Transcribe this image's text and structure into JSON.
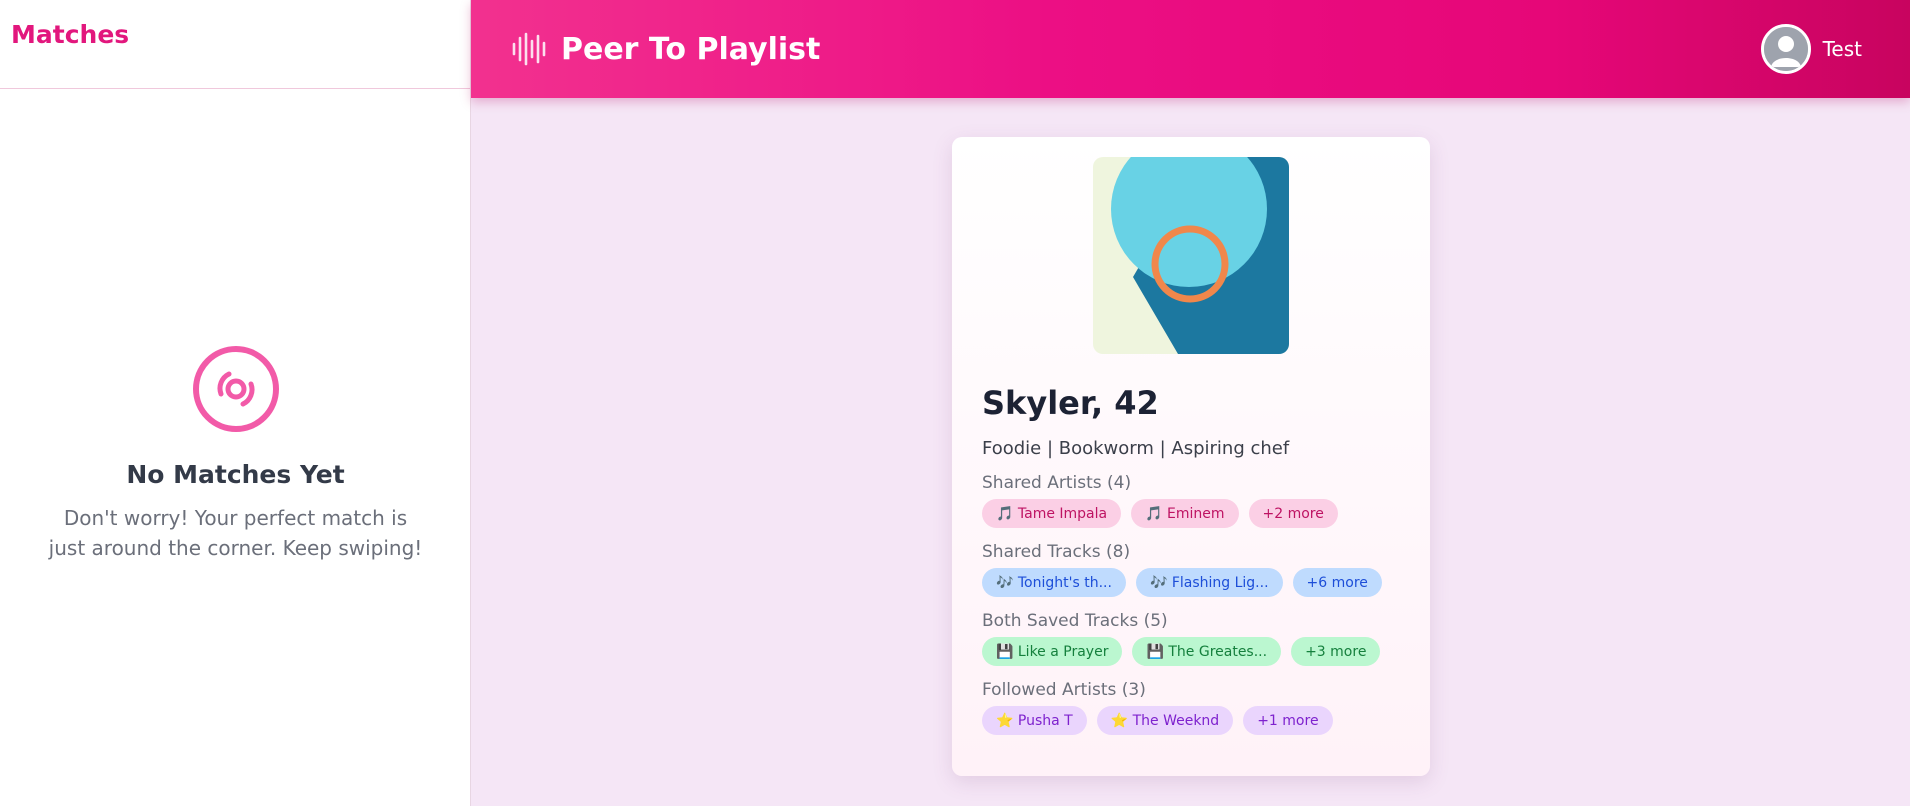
{
  "sidebar": {
    "title": "Matches",
    "empty_state": {
      "icon": "disc-icon",
      "title": "No Matches Yet",
      "text": "Don't worry! Your perfect match is just around the corner. Keep swiping!"
    }
  },
  "header": {
    "logo_icon": "sound-wave-icon",
    "app_name": "Peer To Playlist",
    "user_name": "Test"
  },
  "profile": {
    "name_age": "Skyler, 42",
    "bio": "Foodie | Bookworm | Aspiring chef",
    "sections": [
      {
        "title": "Shared Artists (4)",
        "chips": [
          "🎵 Tame Impala",
          "🎵 Eminem",
          "+2 more"
        ]
      },
      {
        "title": "Shared Tracks (8)",
        "chips": [
          "🎶 Tonight's th...",
          "🎶 Flashing Lig...",
          "+6 more"
        ]
      },
      {
        "title": "Both Saved Tracks (5)",
        "chips": [
          "💾 Like a Prayer",
          "💾 The Greates...",
          "+3 more"
        ]
      },
      {
        "title": "Followed Artists (3)",
        "chips": [
          "⭐ Pusha T",
          "⭐ The Weeknd",
          "+1 more"
        ]
      }
    ]
  },
  "colors": {
    "accent": "#e2177d",
    "header_start": "#f2318f",
    "header_end": "#c8045f",
    "background": "#f5e6f6"
  }
}
